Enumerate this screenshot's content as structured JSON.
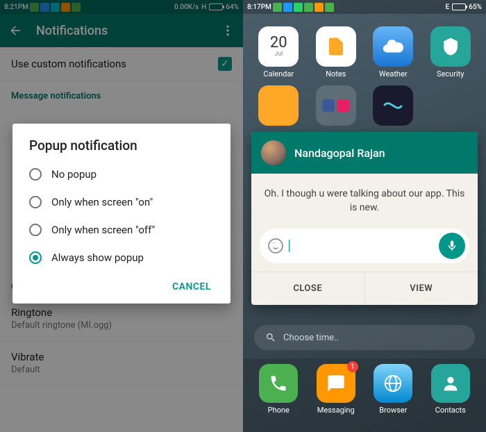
{
  "p1": {
    "status": {
      "time": "8:21PM",
      "net": "0.00K/s",
      "sig": "H",
      "batt": "64%",
      "batt_pct": 64
    },
    "toolbar": {
      "title": "Notifications"
    },
    "row_custom": "Use custom notifications",
    "section_msg": "Message notifications",
    "section_call": "Call notifications",
    "ringtone": {
      "label": "Ringtone",
      "value": "Default ringtone (MI.ogg)"
    },
    "vibrate": {
      "label": "Vibrate",
      "value": "Default"
    },
    "dialog": {
      "title": "Popup notification",
      "options": {
        "o0": "No popup",
        "o1": "Only when screen \"on\"",
        "o2": "Only when screen \"off\"",
        "o3": "Always show popup"
      },
      "cancel": "CANCEL"
    }
  },
  "p2": {
    "status": {
      "time": "8:17PM",
      "sig": "E",
      "batt": "65%",
      "batt_pct": 65
    },
    "apps": {
      "calendar": {
        "day": "20",
        "mon": "Jul",
        "label": "Calendar"
      },
      "notes": "Notes",
      "weather": "Weather",
      "security": "Security"
    },
    "popup": {
      "name": "Nandagopal Rajan",
      "msg": "Oh. I though u were talking about our app. This is new.",
      "close": "CLOSE",
      "view": "VIEW"
    },
    "search": "Choose time..",
    "dock": {
      "phone": "Phone",
      "messaging": "Messaging",
      "msg_badge": "1",
      "browser": "Browser",
      "contacts": "Contacts"
    }
  }
}
